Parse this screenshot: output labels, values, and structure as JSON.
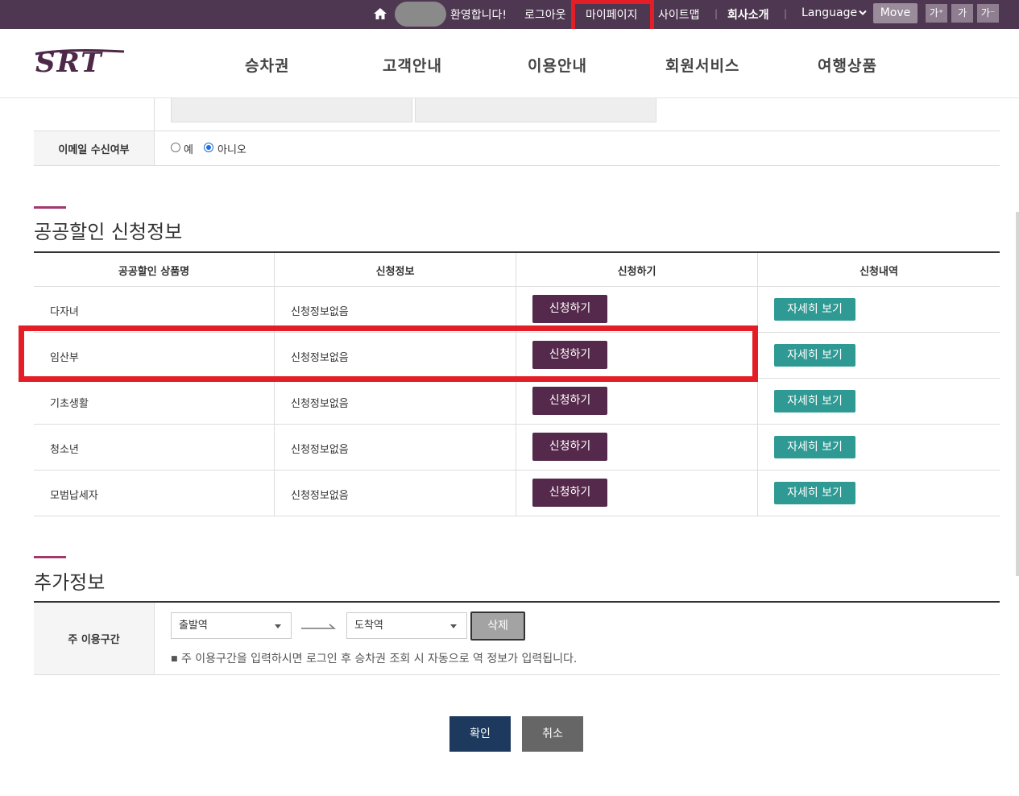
{
  "topbar": {
    "welcome": "환영합니다!",
    "logout": "로그아웃",
    "mypage": "마이페이지",
    "sitemap": "사이트맵",
    "company": "회사소개",
    "language": "Language",
    "move": "Move",
    "font_large": "가⁺",
    "font_normal": "가",
    "font_small": "가⁻"
  },
  "header": {
    "logo": "SRT",
    "nav": [
      "승차권",
      "고객안내",
      "이용안내",
      "회원서비스",
      "여행상품"
    ]
  },
  "email_row": {
    "label": "이메일 수신여부",
    "options": [
      "예",
      "아니오"
    ],
    "selected": "아니오"
  },
  "discount": {
    "title": "공공할인 신청정보",
    "headers": [
      "공공할인 상품명",
      "신청정보",
      "신청하기",
      "신청내역"
    ],
    "rows": [
      {
        "name": "다자녀",
        "info": "신청정보없음",
        "apply": "신청하기",
        "detail": "자세히 보기"
      },
      {
        "name": "임산부",
        "info": "신청정보없음",
        "apply": "신청하기",
        "detail": "자세히 보기"
      },
      {
        "name": "기초생활",
        "info": "신청정보없음",
        "apply": "신청하기",
        "detail": "자세히 보기"
      },
      {
        "name": "청소년",
        "info": "신청정보없음",
        "apply": "신청하기",
        "detail": "자세히 보기"
      },
      {
        "name": "모범납세자",
        "info": "신청정보없음",
        "apply": "신청하기",
        "detail": "자세히 보기"
      }
    ]
  },
  "additional": {
    "title": "추가정보",
    "route_label": "주 이용구간",
    "departure": "출발역",
    "arrival": "도착역",
    "delete": "삭제",
    "note": "주 이용구간을 입력하시면 로그인 후 승차권 조회 시 자동으로 역 정보가 입력됩니다."
  },
  "actions": {
    "confirm": "확인",
    "cancel": "취소"
  },
  "colors": {
    "topbar": "#4e3750",
    "apply_button": "#55294b",
    "detail_button": "#2e9a93",
    "highlight": "#e41e26",
    "confirm": "#1d3a5e"
  }
}
